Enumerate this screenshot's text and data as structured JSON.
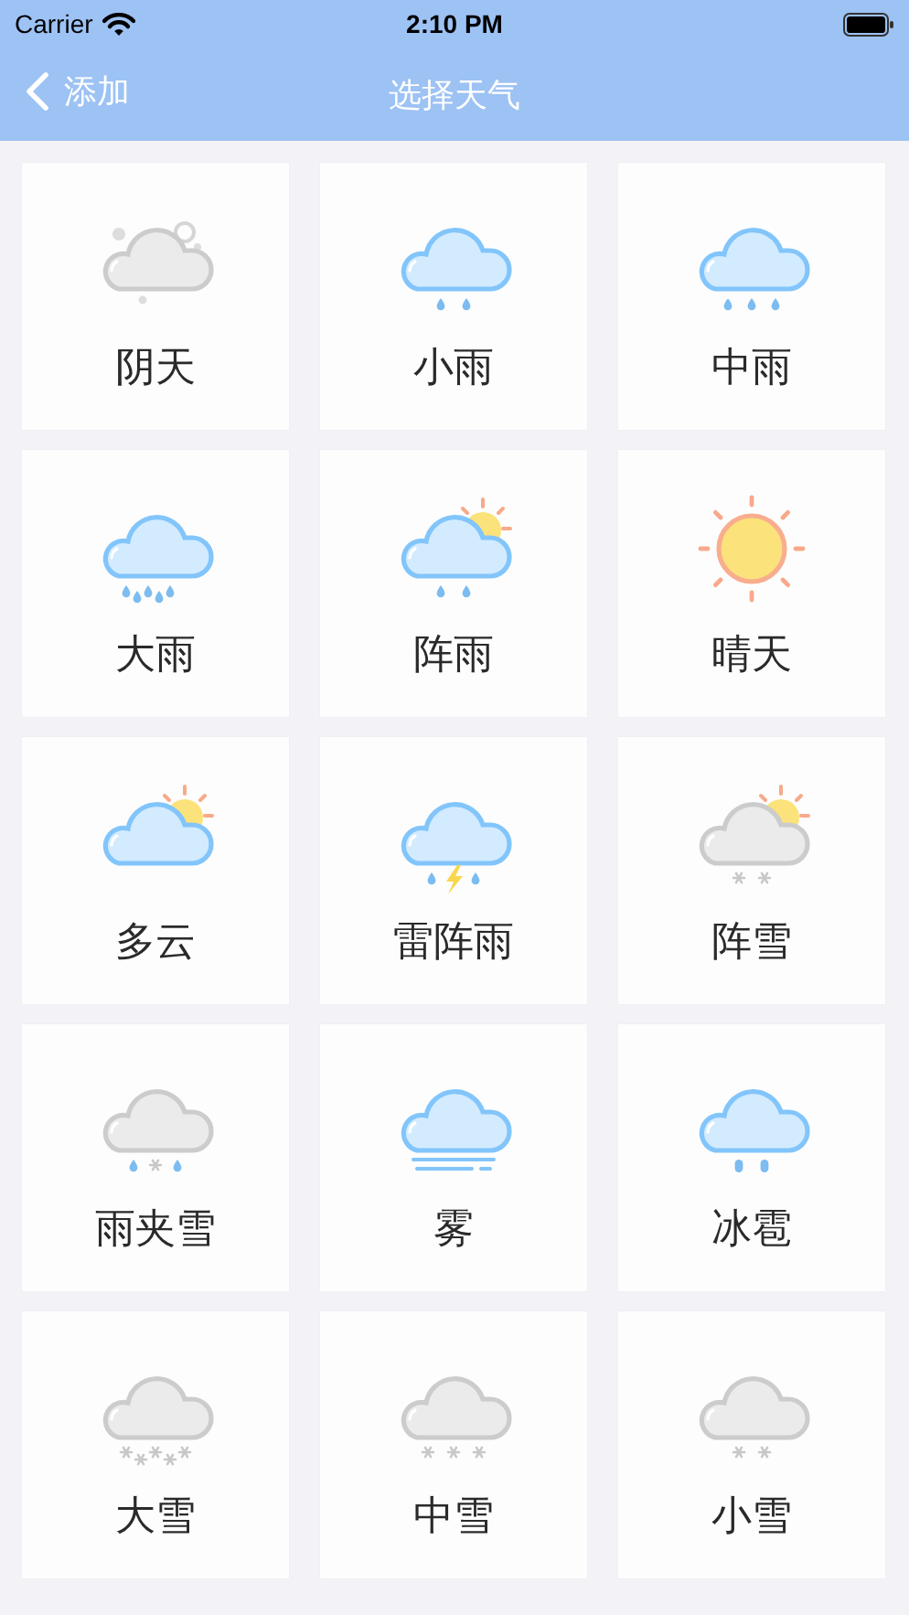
{
  "status_bar": {
    "carrier": "Carrier",
    "time": "2:10 PM"
  },
  "nav_bar": {
    "back_label": "添加",
    "title": "选择天气"
  },
  "weather_options": [
    {
      "label": "阴天",
      "kind": "overcast"
    },
    {
      "label": "小雨",
      "kind": "light_rain"
    },
    {
      "label": "中雨",
      "kind": "moderate_rain"
    },
    {
      "label": "大雨",
      "kind": "heavy_rain"
    },
    {
      "label": "阵雨",
      "kind": "shower"
    },
    {
      "label": "晴天",
      "kind": "sunny"
    },
    {
      "label": "多云",
      "kind": "cloudy"
    },
    {
      "label": "雷阵雨",
      "kind": "thunder_shower"
    },
    {
      "label": "阵雪",
      "kind": "snow_shower"
    },
    {
      "label": "雨夹雪",
      "kind": "sleet"
    },
    {
      "label": "雾",
      "kind": "fog"
    },
    {
      "label": "冰雹",
      "kind": "hail"
    },
    {
      "label": "大雪",
      "kind": "heavy_snow"
    },
    {
      "label": "中雪",
      "kind": "moderate_snow"
    },
    {
      "label": "小雪",
      "kind": "light_snow"
    }
  ]
}
